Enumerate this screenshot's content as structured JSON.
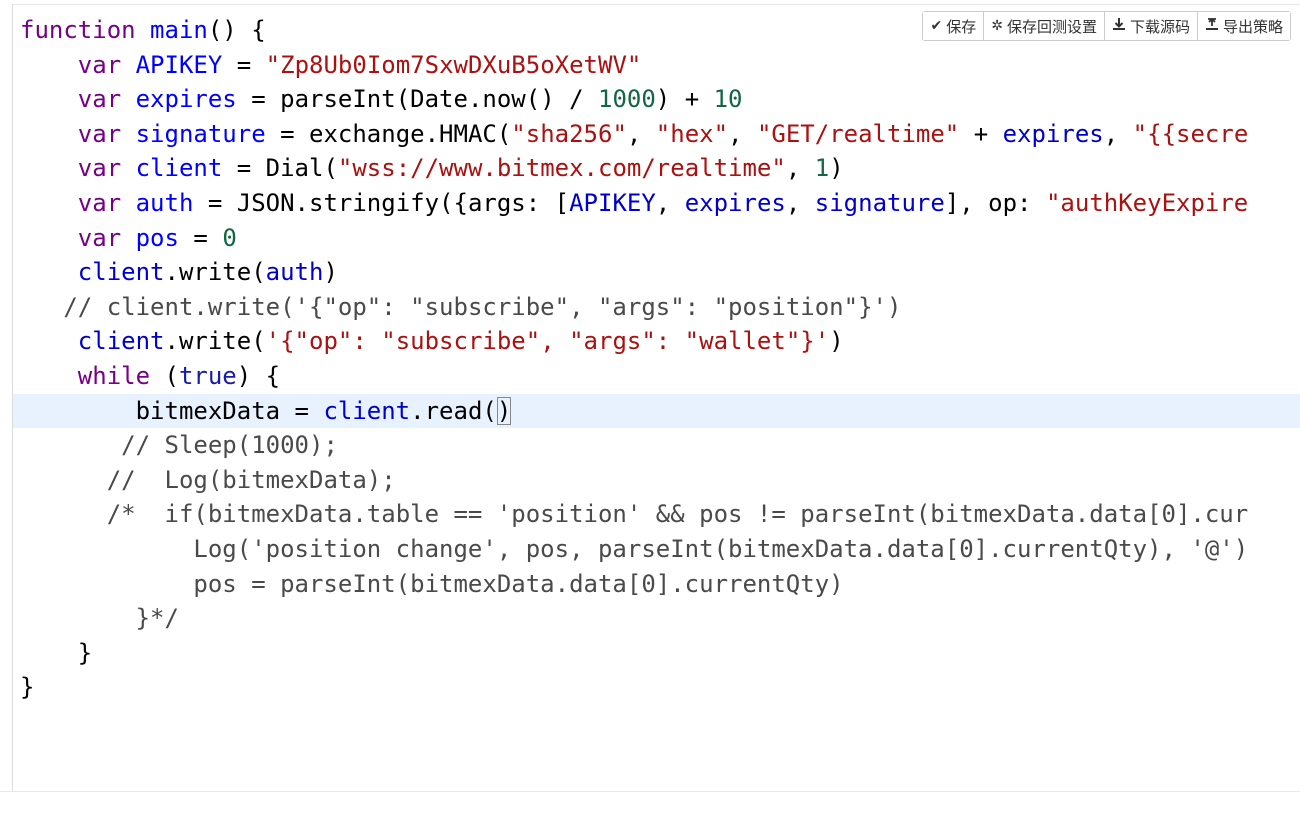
{
  "toolbar": {
    "save": {
      "icon": "checkmark-icon",
      "label": "保存"
    },
    "save_backtest": {
      "icon": "gear-icon",
      "label": "保存回测设置"
    },
    "download": {
      "icon": "download-icon",
      "label": "下载源码"
    },
    "export": {
      "icon": "export-icon",
      "label": "导出策略"
    }
  },
  "code": {
    "l1": {
      "a": "function",
      "b": " ",
      "c": "main",
      "d": "() {"
    },
    "l2": {
      "a": "    ",
      "b": "var",
      "c": " ",
      "d": "APIKEY",
      "e": " = ",
      "f": "\"Zp8Ub0Iom7SxwDXuB5oXetWV\""
    },
    "l3": {
      "a": "    ",
      "b": "var",
      "c": " ",
      "d": "expires",
      "e": " = parseInt(Date.now() / ",
      "f": "1000",
      "g": ") + ",
      "h": "10"
    },
    "l4": {
      "a": "    ",
      "b": "var",
      "c": " ",
      "d": "signature",
      "e": " = exchange.HMAC(",
      "f": "\"sha256\"",
      "g": ", ",
      "h": "\"hex\"",
      "i": ", ",
      "j": "\"GET/realtime\"",
      "k": " + ",
      "l": "expires",
      "m": ", ",
      "n": "\"{{secre"
    },
    "l5": {
      "a": "    ",
      "b": "var",
      "c": " ",
      "d": "client",
      "e": " = Dial(",
      "f": "\"wss://www.bitmex.com/realtime\"",
      "g": ", ",
      "h": "1",
      "i": ")"
    },
    "l6": {
      "a": "    ",
      "b": "var",
      "c": " ",
      "d": "auth",
      "e": " = JSON.stringify({args: [",
      "f": "APIKEY",
      "g": ", ",
      "h": "expires",
      "i": ", ",
      "j": "signature",
      "k": "], op: ",
      "l": "\"authKeyExpire"
    },
    "l7": {
      "a": "    ",
      "b": "var",
      "c": " ",
      "d": "pos",
      "e": " = ",
      "f": "0"
    },
    "l8": {
      "a": "    ",
      "b": "client",
      "c": ".write(",
      "d": "auth",
      "e": ")"
    },
    "l9": {
      "a": "   ",
      "b": "// client.write('{\"op\": \"subscribe\", \"args\": \"position\"}')"
    },
    "l10": {
      "a": "    ",
      "b": "client",
      "c": ".write(",
      "d": "'{\"op\": \"subscribe\", \"args\": \"wallet\"}'",
      "e": ")"
    },
    "l11": {
      "a": "    ",
      "b": "while",
      "c": " (",
      "d": "true",
      "e": ") {"
    },
    "l12": {
      "a": "        bitmexData = ",
      "b": "client",
      "c": ".read(",
      "d": ")"
    },
    "l13": {
      "a": "       ",
      "b": "// Sleep(1000);"
    },
    "l14": {
      "a": "      ",
      "b": "//  Log(bitmexData);"
    },
    "l15": {
      "a": "      ",
      "b": "/*  if(bitmexData.table == 'position' && pos != parseInt(bitmexData.data[0].cur"
    },
    "l16": {
      "a": "            ",
      "b": "Log('position change', pos, parseInt(bitmexData.data[0].currentQty), '@')"
    },
    "l17": {
      "a": "            ",
      "b": "pos = parseInt(bitmexData.data[0].currentQty)"
    },
    "l18": {
      "a": "        ",
      "b": "}*/"
    },
    "l19": {
      "a": "    }"
    },
    "l20": {
      "a": "}"
    }
  }
}
